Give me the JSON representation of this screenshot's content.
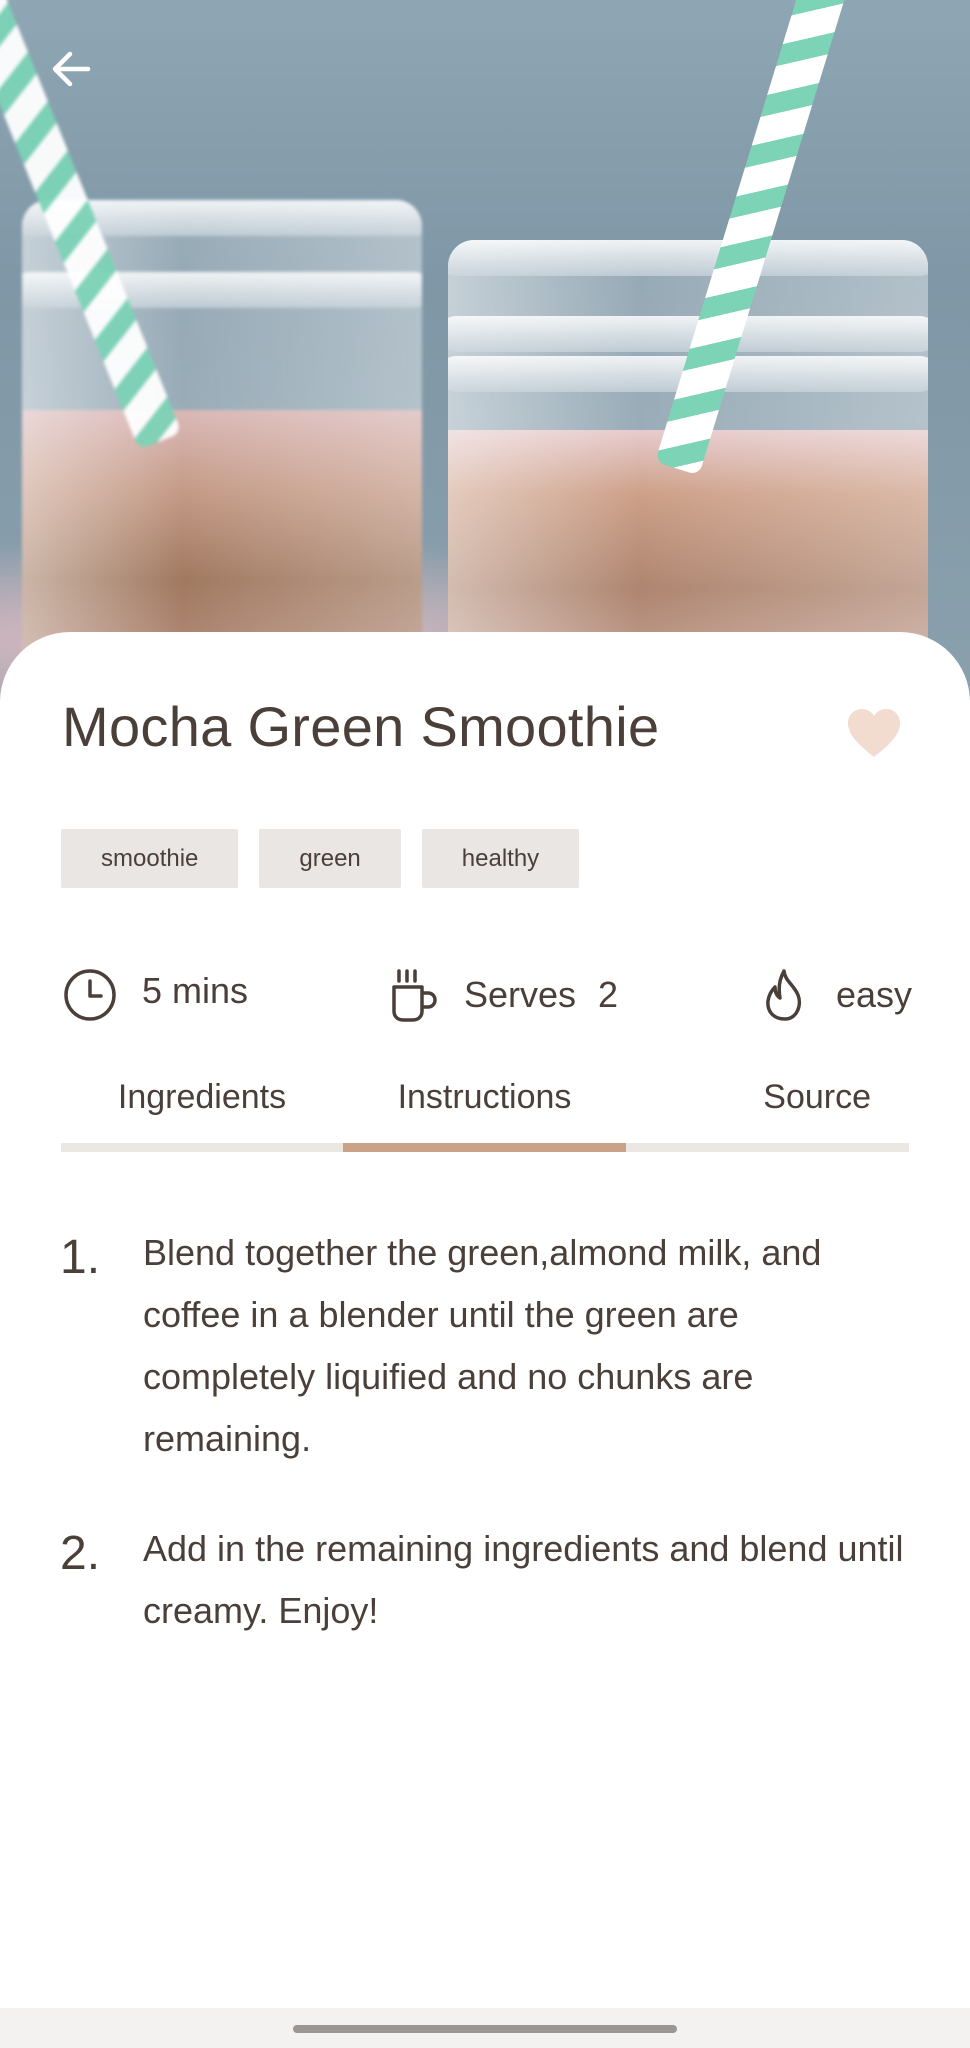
{
  "recipe": {
    "title": "Mocha Green Smoothie",
    "tags": [
      "smoothie",
      "green",
      "healthy"
    ],
    "time": "5 mins",
    "serves_label": "Serves",
    "serves_count": "2",
    "difficulty": "easy"
  },
  "tabs": [
    {
      "label": "Ingredients",
      "active": false
    },
    {
      "label": "Instructions",
      "active": true
    },
    {
      "label": "Source",
      "active": false
    }
  ],
  "instructions": [
    {
      "number": "1.",
      "text": "Blend together the green,almond milk, and coffee in a blender until the green are completely liquified and no chunks are remaining."
    },
    {
      "number": "2.",
      "text": "Add in the remaining ingredients and blend until creamy. Enjoy!"
    }
  ],
  "icons": {
    "back": "arrow-left-icon",
    "favorite": "heart-icon",
    "time": "clock-icon",
    "serves": "cup-icon",
    "difficulty": "flame-icon"
  },
  "colors": {
    "text": "#4a3f39",
    "accent": "#c9a287",
    "favorite": "#f1dccf",
    "tag_bg": "#e9e6e4",
    "tab_track": "#ebe7e3"
  }
}
